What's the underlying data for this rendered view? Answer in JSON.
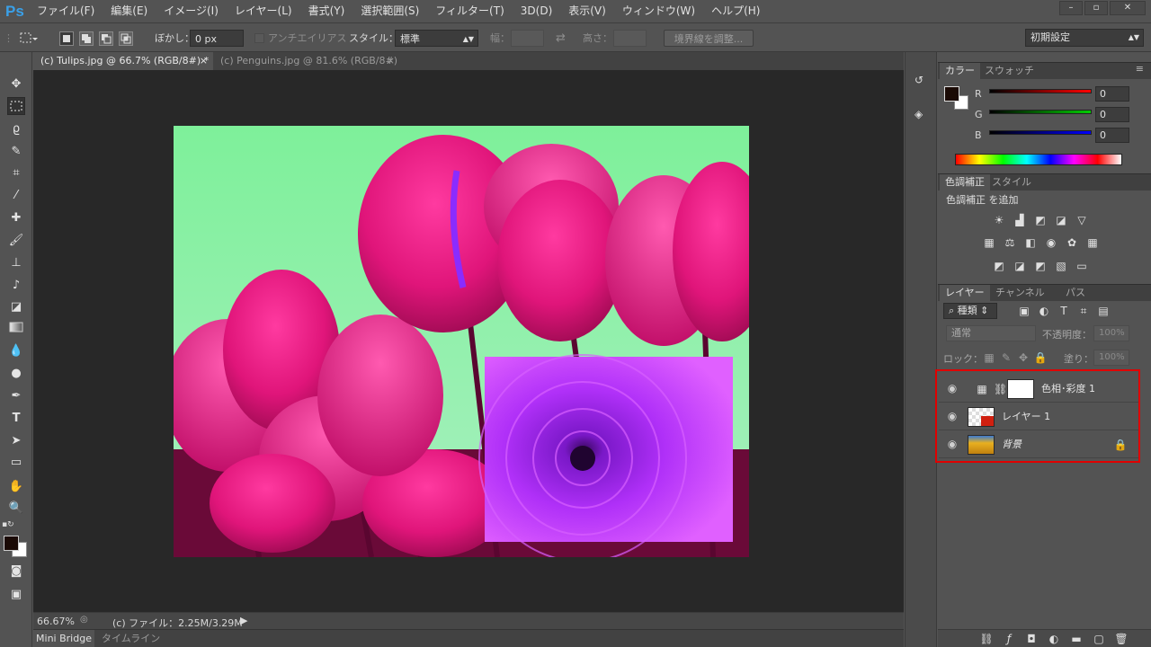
{
  "app": {
    "logo": "Ps"
  },
  "menubar": {
    "items": [
      "ファイル(F)",
      "編集(E)",
      "イメージ(I)",
      "レイヤー(L)",
      "書式(Y)",
      "選択範囲(S)",
      "フィルター(T)",
      "3D(D)",
      "表示(V)",
      "ウィンドウ(W)",
      "ヘルプ(H)"
    ]
  },
  "window": {
    "minimize": "–",
    "restore": "▫",
    "close": "✕"
  },
  "options": {
    "feather_label": "ぼかし：",
    "feather_value": "0 px",
    "antialias_label": "アンチエイリアス",
    "style_label": "スタイル：",
    "style_value": "標準",
    "width_label": "幅：",
    "height_label": "高さ：",
    "refine_edge": "境界線を調整...",
    "workspace": "初期設定"
  },
  "tabs": [
    {
      "label": "(c) Tulips.jpg @ 66.7% (RGB/8#) *",
      "close": "×"
    },
    {
      "label": "(c) Penguins.jpg @ 81.6% (RGB/8#)",
      "close": "×"
    }
  ],
  "status": {
    "zoom": "66.67%",
    "file_info": "(c) ファイル：2.25M/3.29M"
  },
  "bottom_tabs": [
    "Mini Bridge",
    "タイムライン"
  ],
  "color_panel": {
    "tabs": [
      "カラー",
      "スウォッチ"
    ],
    "r_label": "R",
    "g_label": "G",
    "b_label": "B",
    "r_value": "0",
    "g_value": "0",
    "b_value": "0",
    "foreground_color": "#1a0a05",
    "background_color": "#ffffff"
  },
  "adjustments_panel": {
    "tabs": [
      "色調補正",
      "スタイル"
    ],
    "title": "色調補正 を追加"
  },
  "layers_panel": {
    "tabs": [
      "レイヤー",
      "チャンネル",
      "パス"
    ],
    "filter_kind": "種類",
    "blend_mode": "通常",
    "opacity_label": "不透明度：",
    "opacity_value": "100%",
    "lock_label": "ロック：",
    "fill_label": "塗り：",
    "fill_value": "100%",
    "layers": [
      {
        "name": "色相･彩度 1"
      },
      {
        "name": "レイヤー 1"
      },
      {
        "name": "背景"
      }
    ]
  },
  "colors": {
    "highlight": "#e00000",
    "tulip": "#e0157a",
    "chrysanthemum": "#a020f0",
    "sky": "#8ae8a2"
  }
}
